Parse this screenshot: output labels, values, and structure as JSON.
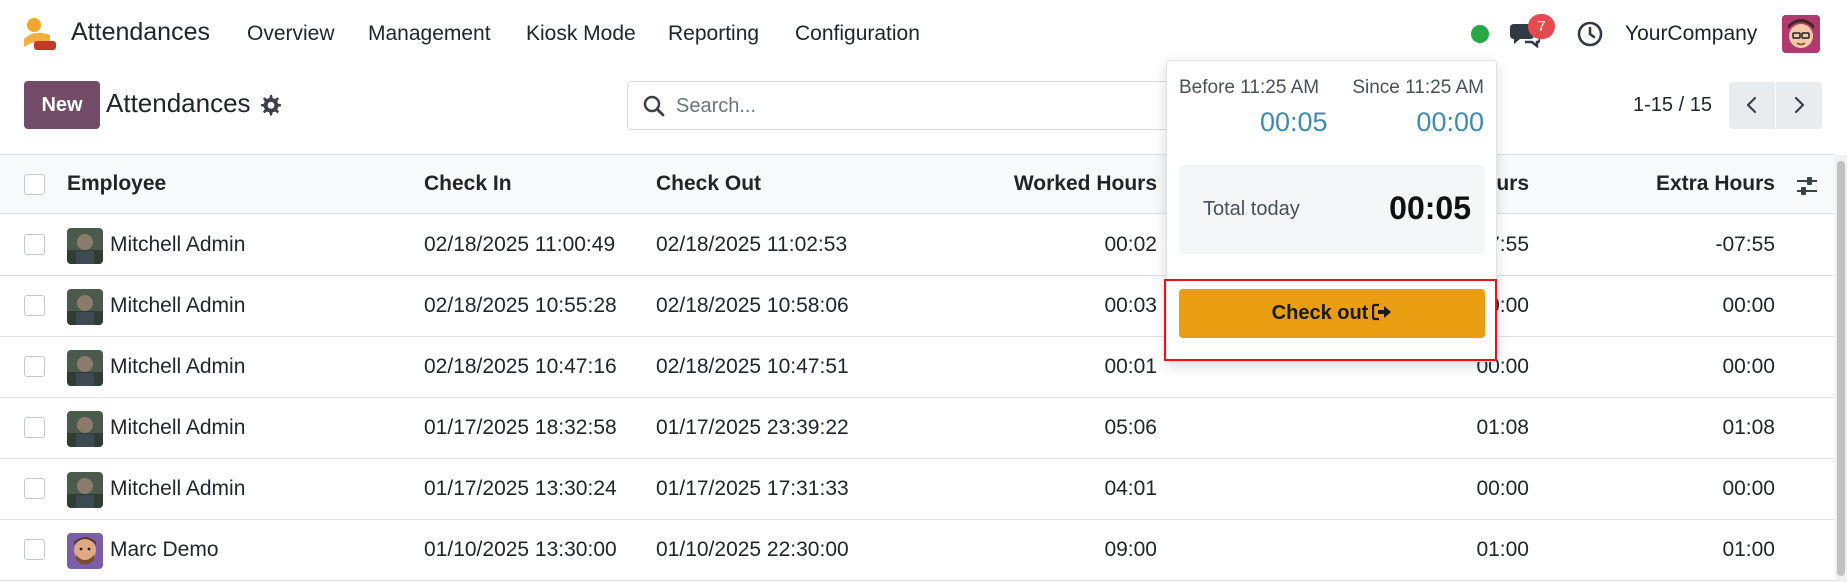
{
  "navbar": {
    "app_name": "Attendances",
    "menus": [
      "Overview",
      "Management",
      "Kiosk Mode",
      "Reporting",
      "Configuration"
    ],
    "chat_badge": "7",
    "company": "YourCompany",
    "status_color": "#28a745"
  },
  "control": {
    "new_label": "New",
    "title": "Attendances",
    "search_placeholder": "Search...",
    "pager": "1-15 / 15"
  },
  "table": {
    "columns": [
      "Employee",
      "Check In",
      "Check Out",
      "Worked Hours",
      "urs",
      "Extra Hours"
    ],
    "rows": [
      {
        "employee": "Mitchell Admin",
        "avatar": "mitchell",
        "check_in": "02/18/2025 11:00:49",
        "check_out": "02/18/2025 11:02:53",
        "worked": "00:02",
        "overtime": "7:55",
        "extra": "-07:55"
      },
      {
        "employee": "Mitchell Admin",
        "avatar": "mitchell",
        "check_in": "02/18/2025 10:55:28",
        "check_out": "02/18/2025 10:58:06",
        "worked": "00:03",
        "overtime": "00:00",
        "extra": "00:00"
      },
      {
        "employee": "Mitchell Admin",
        "avatar": "mitchell",
        "check_in": "02/18/2025 10:47:16",
        "check_out": "02/18/2025 10:47:51",
        "worked": "00:01",
        "overtime": "00:00",
        "extra": "00:00"
      },
      {
        "employee": "Mitchell Admin",
        "avatar": "mitchell",
        "check_in": "01/17/2025 18:32:58",
        "check_out": "01/17/2025 23:39:22",
        "worked": "05:06",
        "overtime": "01:08",
        "extra": "01:08"
      },
      {
        "employee": "Mitchell Admin",
        "avatar": "mitchell",
        "check_in": "01/17/2025 13:30:24",
        "check_out": "01/17/2025 17:31:33",
        "worked": "04:01",
        "overtime": "00:00",
        "extra": "00:00"
      },
      {
        "employee": "Marc Demo",
        "avatar": "marc",
        "check_in": "01/10/2025 13:30:00",
        "check_out": "01/10/2025 22:30:00",
        "worked": "09:00",
        "overtime": "01:00",
        "extra": "01:00"
      }
    ]
  },
  "popover": {
    "before_label": "Before 11:25 AM",
    "before_value": "00:05",
    "since_label": "Since 11:25 AM",
    "since_value": "00:00",
    "total_label": "Total today",
    "total_value": "00:05",
    "checkout_label": "Check out",
    "button_color": "#e99d11",
    "highlight_color": "#e4141b"
  }
}
